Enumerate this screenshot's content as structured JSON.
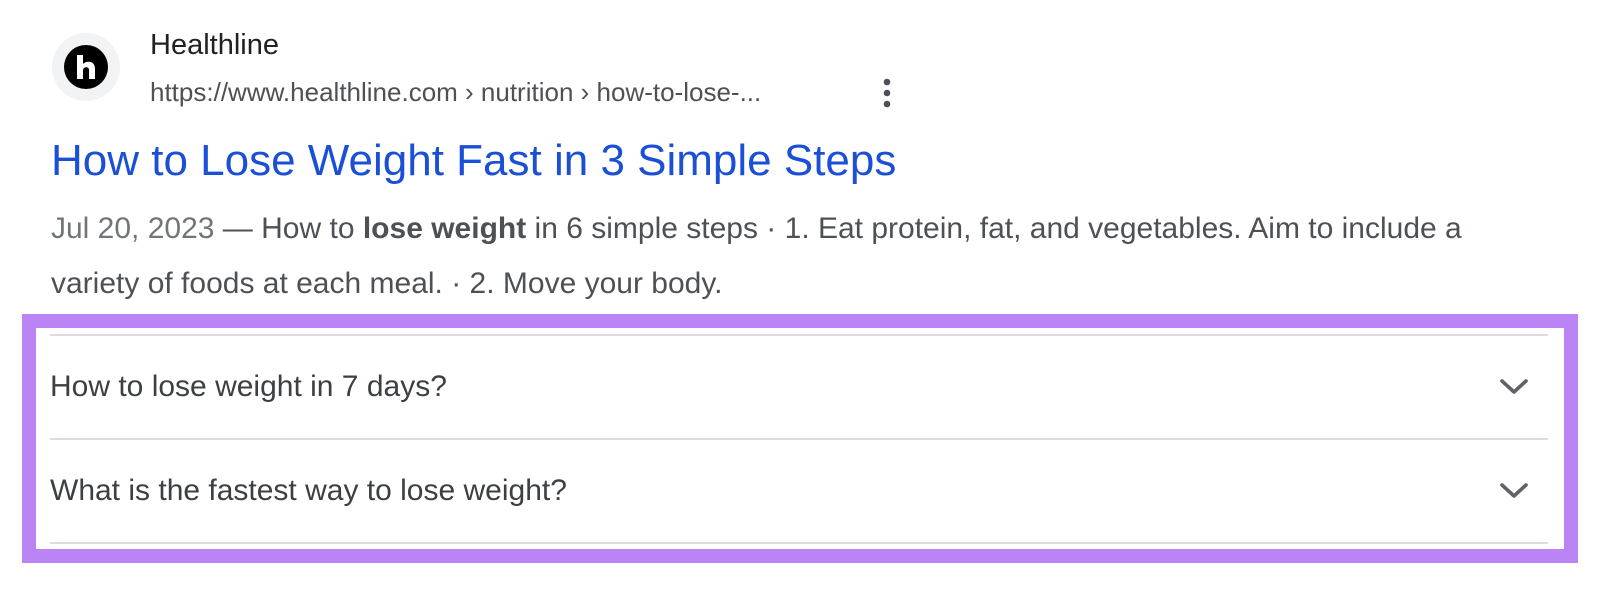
{
  "source": {
    "logo_icon": "healthline-h-logo-icon",
    "name": "Healthline",
    "url_path": "https://www.healthline.com › nutrition › how-to-lose-...",
    "more_icon": "vertical-dots-icon"
  },
  "result": {
    "title": "How to Lose Weight Fast in 3 Simple Steps",
    "title_color": "#1a4fd6",
    "date": "Jul 20, 2023",
    "snippet_pre": " — How to ",
    "snippet_bold": "lose weight",
    "snippet_post": " in 6 simple steps · 1. Eat protein, fat, and vegetables. Aim to include a variety of foods at each meal. · 2. Move your body."
  },
  "faq": {
    "highlight_color": "#bb84f6",
    "items": [
      {
        "question": "How to lose weight in 7 days?",
        "icon": "chevron-down-icon"
      },
      {
        "question": "What is the fastest way to lose weight?",
        "icon": "chevron-down-icon"
      }
    ]
  }
}
